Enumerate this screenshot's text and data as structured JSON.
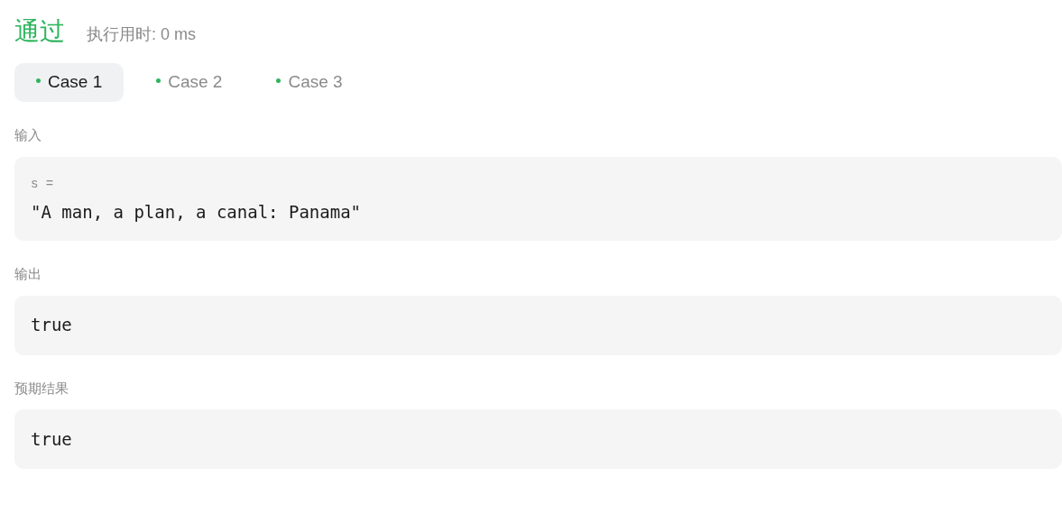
{
  "result": {
    "status": "通过",
    "runtime": "执行用时: 0 ms"
  },
  "cases": [
    {
      "label": "Case 1",
      "selected": true,
      "passed": true
    },
    {
      "label": "Case 2",
      "selected": false,
      "passed": true
    },
    {
      "label": "Case 3",
      "selected": false,
      "passed": true
    }
  ],
  "input": {
    "heading": "输入",
    "variables": [
      {
        "name": "s =",
        "value": "\"A man, a plan, a canal: Panama\""
      }
    ]
  },
  "output": {
    "heading": "输出",
    "value": "true"
  },
  "expected": {
    "heading": "预期结果",
    "value": "true"
  }
}
